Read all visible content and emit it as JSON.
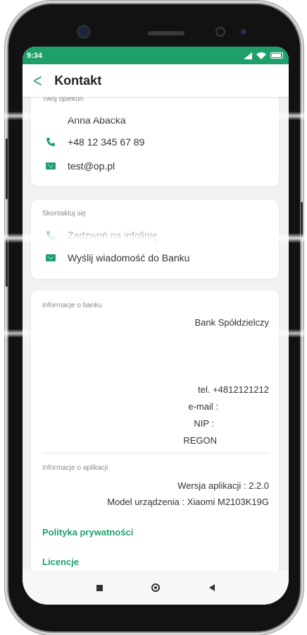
{
  "status_bar": {
    "time": "9:34"
  },
  "header": {
    "title": "Kontakt",
    "back_icon": "chevron-left-icon"
  },
  "guardian": {
    "label": "Twój opiekun",
    "name": "Anna Abacka",
    "phone": "+48 12 345 67 89",
    "email": "test@op.pl"
  },
  "contact": {
    "label": "Skontaktuj się",
    "call": "Zadzwoń na infolinię",
    "message": "Wyślij wiadomość do Banku"
  },
  "bank_info": {
    "label": "Informacje o banku",
    "name": "Bank Spółdzielczy",
    "tel": "tel. +4812121212",
    "email": "e-mail :",
    "nip": "NIP :",
    "regon": "REGON"
  },
  "app_info": {
    "label": "Informacje o aplikacji",
    "version": "Wersja aplikacji : 2.2.0",
    "device": "Model urządzenia : Xiaomi M2103K19G"
  },
  "links": {
    "privacy": "Polityka prywatności",
    "licenses": "Licencje"
  },
  "colors": {
    "accent": "#1fa06b"
  }
}
